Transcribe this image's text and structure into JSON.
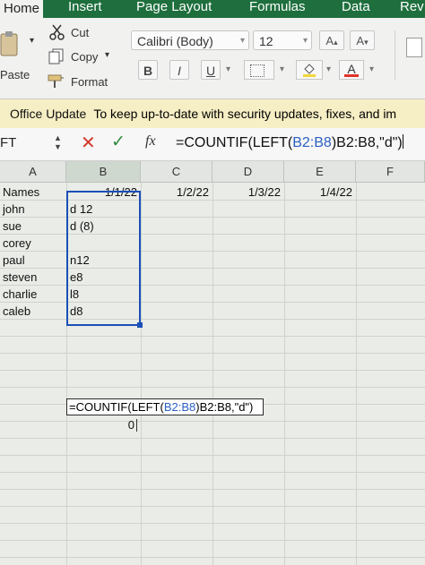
{
  "ribbon": {
    "tabs": [
      "Home",
      "Insert",
      "Page Layout",
      "Formulas",
      "Data",
      "Rev"
    ],
    "active_tab": "Home",
    "clipboard": {
      "cut": "Cut",
      "copy": "Copy",
      "paste": "Paste",
      "format": "Format"
    },
    "font_name": "Calibri (Body)",
    "font_size": "12",
    "grow_font": "A",
    "shrink_font": "A",
    "bold": "B",
    "italic": "I",
    "underline": "U",
    "font_color": "A"
  },
  "update_bar": {
    "title": "Office Update",
    "message": "To keep up-to-date with security updates, fixes, and im"
  },
  "formula_bar": {
    "name_box": "FT",
    "fx_label": "fx",
    "formula_parts": [
      "=COUNTIF(LEFT(",
      "B2:B8",
      ")B2:B8,\"d\")"
    ]
  },
  "sheet": {
    "columns": [
      "A",
      "B",
      "C",
      "D",
      "E",
      "F"
    ],
    "header_row": [
      "Names",
      "1/1/22",
      "1/2/22",
      "1/3/22",
      "1/4/22"
    ],
    "rows": [
      {
        "name": "john",
        "b": "d 12"
      },
      {
        "name": "sue",
        "b": "d (8)"
      },
      {
        "name": "corey",
        "b": ""
      },
      {
        "name": "paul",
        "b": "n12"
      },
      {
        "name": "steven",
        "b": "e8"
      },
      {
        "name": "charlie",
        "b": "l8"
      },
      {
        "name": "caleb",
        "b": "d8"
      }
    ],
    "edit_cell_parts": [
      "=COUNTIF(LEFT(",
      "B2:B8",
      ")B2:B8,\"d\")"
    ],
    "result_value": "0"
  }
}
